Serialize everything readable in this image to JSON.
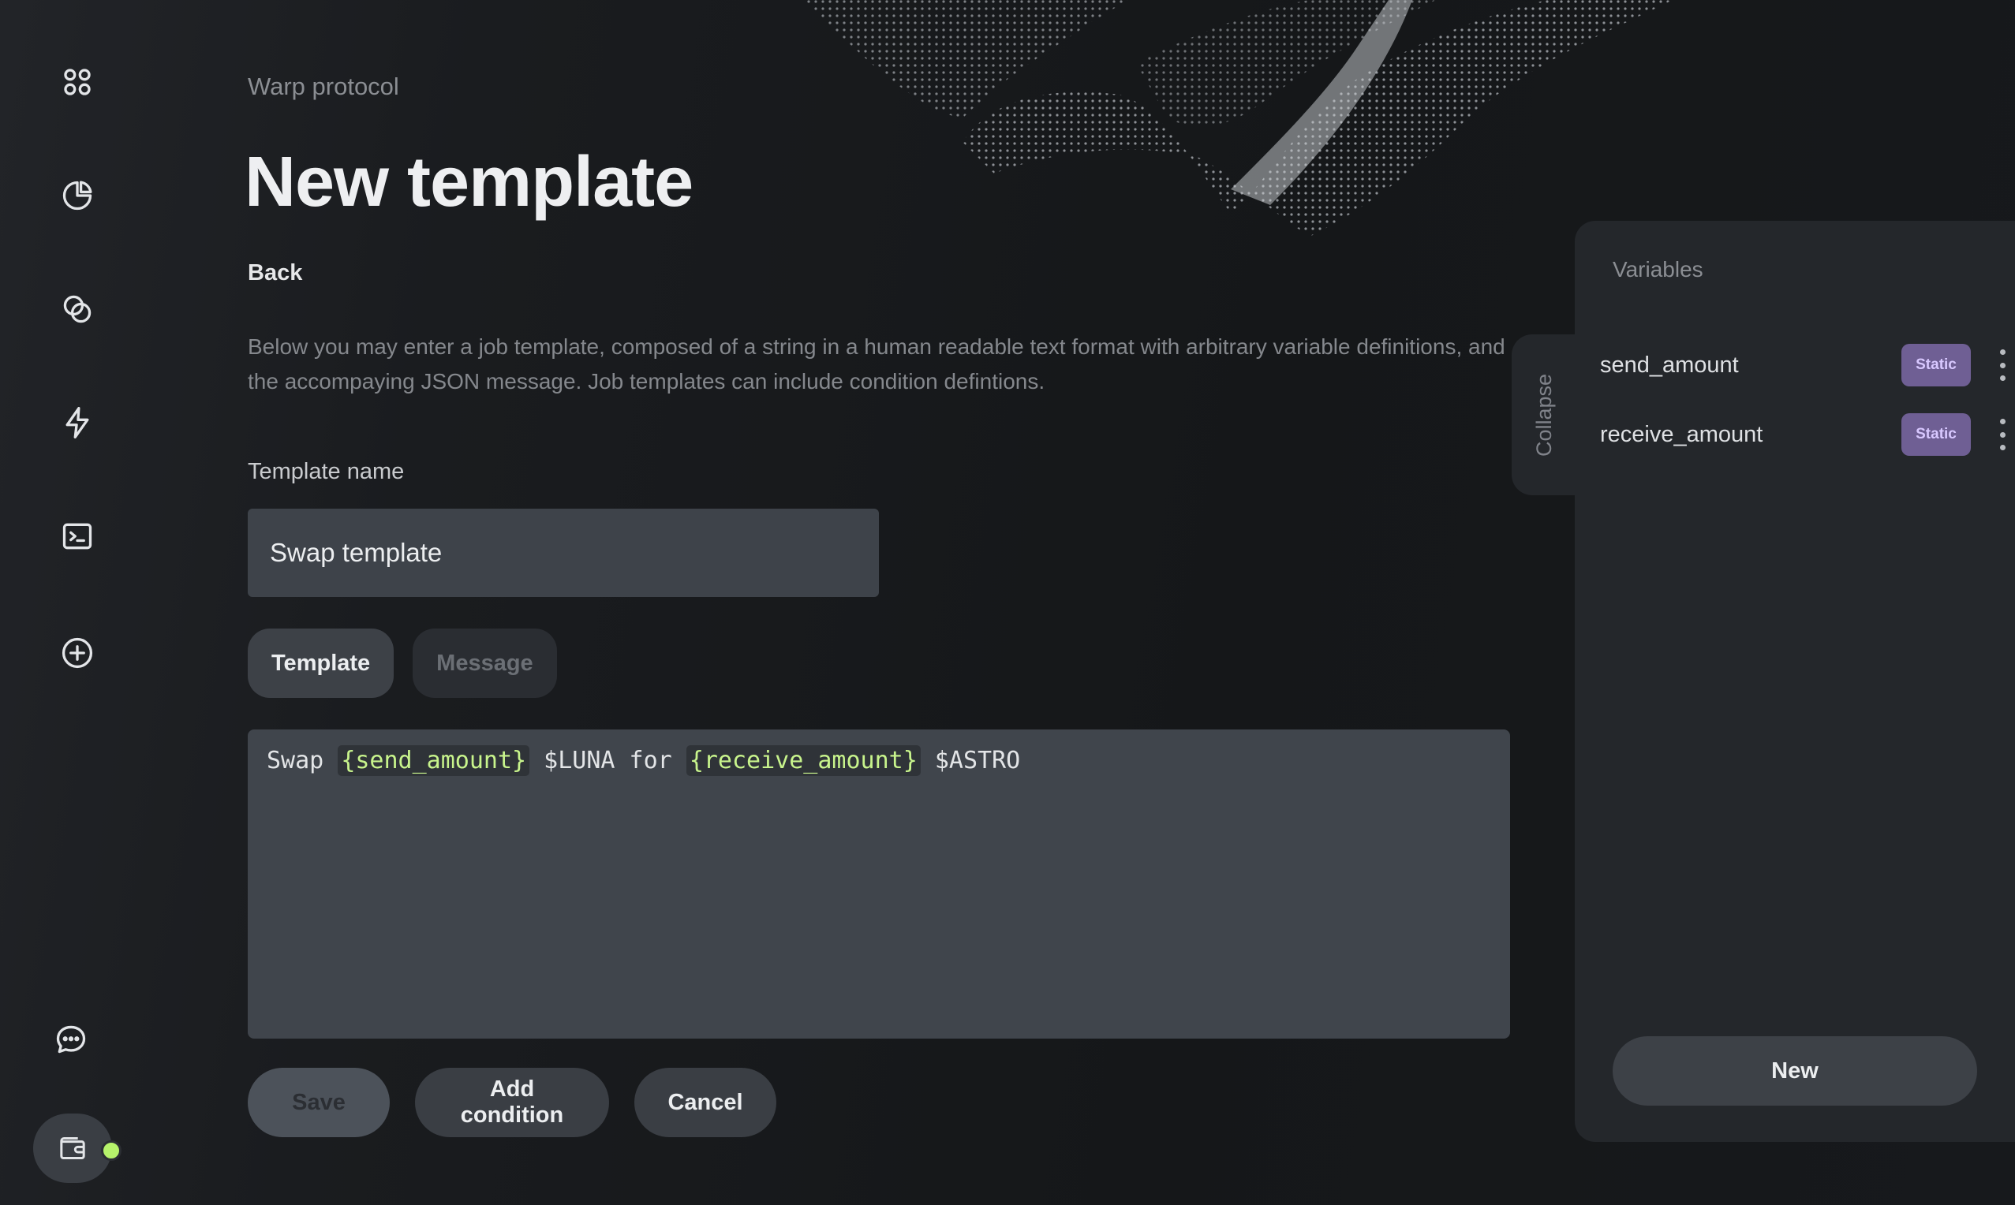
{
  "sidebar": {
    "items": [
      {
        "icon": "apps-grid-icon"
      },
      {
        "icon": "pie-chart-icon"
      },
      {
        "icon": "coins-icon"
      },
      {
        "icon": "lightning-icon"
      },
      {
        "icon": "terminal-icon"
      },
      {
        "icon": "add-circle-icon"
      }
    ],
    "chat_icon": "chat-icon",
    "wallet_icon": "wallet-icon",
    "status_color": "#b6f36b"
  },
  "header": {
    "breadcrumb": "Warp protocol",
    "title": "New template",
    "back_label": "Back"
  },
  "description": "Below you may enter a job template, composed of a string in a human readable text format with arbitrary variable definitions, and the accompaying JSON message. Job templates can include condition defintions.",
  "form": {
    "name_label": "Template name",
    "name_value": "Swap template",
    "tabs": [
      {
        "label": "Template",
        "active": true
      },
      {
        "label": "Message",
        "active": false
      }
    ],
    "editor": {
      "tokens": [
        {
          "text": "Swap ",
          "type": "text"
        },
        {
          "text": "{send_amount}",
          "type": "var"
        },
        {
          "text": " $LUNA for ",
          "type": "text"
        },
        {
          "text": "{receive_amount}",
          "type": "var"
        },
        {
          "text": " $ASTRO",
          "type": "text"
        }
      ]
    },
    "actions": {
      "save_label": "Save",
      "add_condition_label": "Add condition",
      "cancel_label": "Cancel"
    }
  },
  "variables_panel": {
    "collapse_label": "Collapse",
    "title": "Variables",
    "items": [
      {
        "name": "send_amount",
        "kind": "Static"
      },
      {
        "name": "receive_amount",
        "kind": "Static"
      }
    ],
    "new_label": "New"
  },
  "colors": {
    "accent_green": "#c8f48c",
    "badge_purple": "#6f5f94"
  }
}
